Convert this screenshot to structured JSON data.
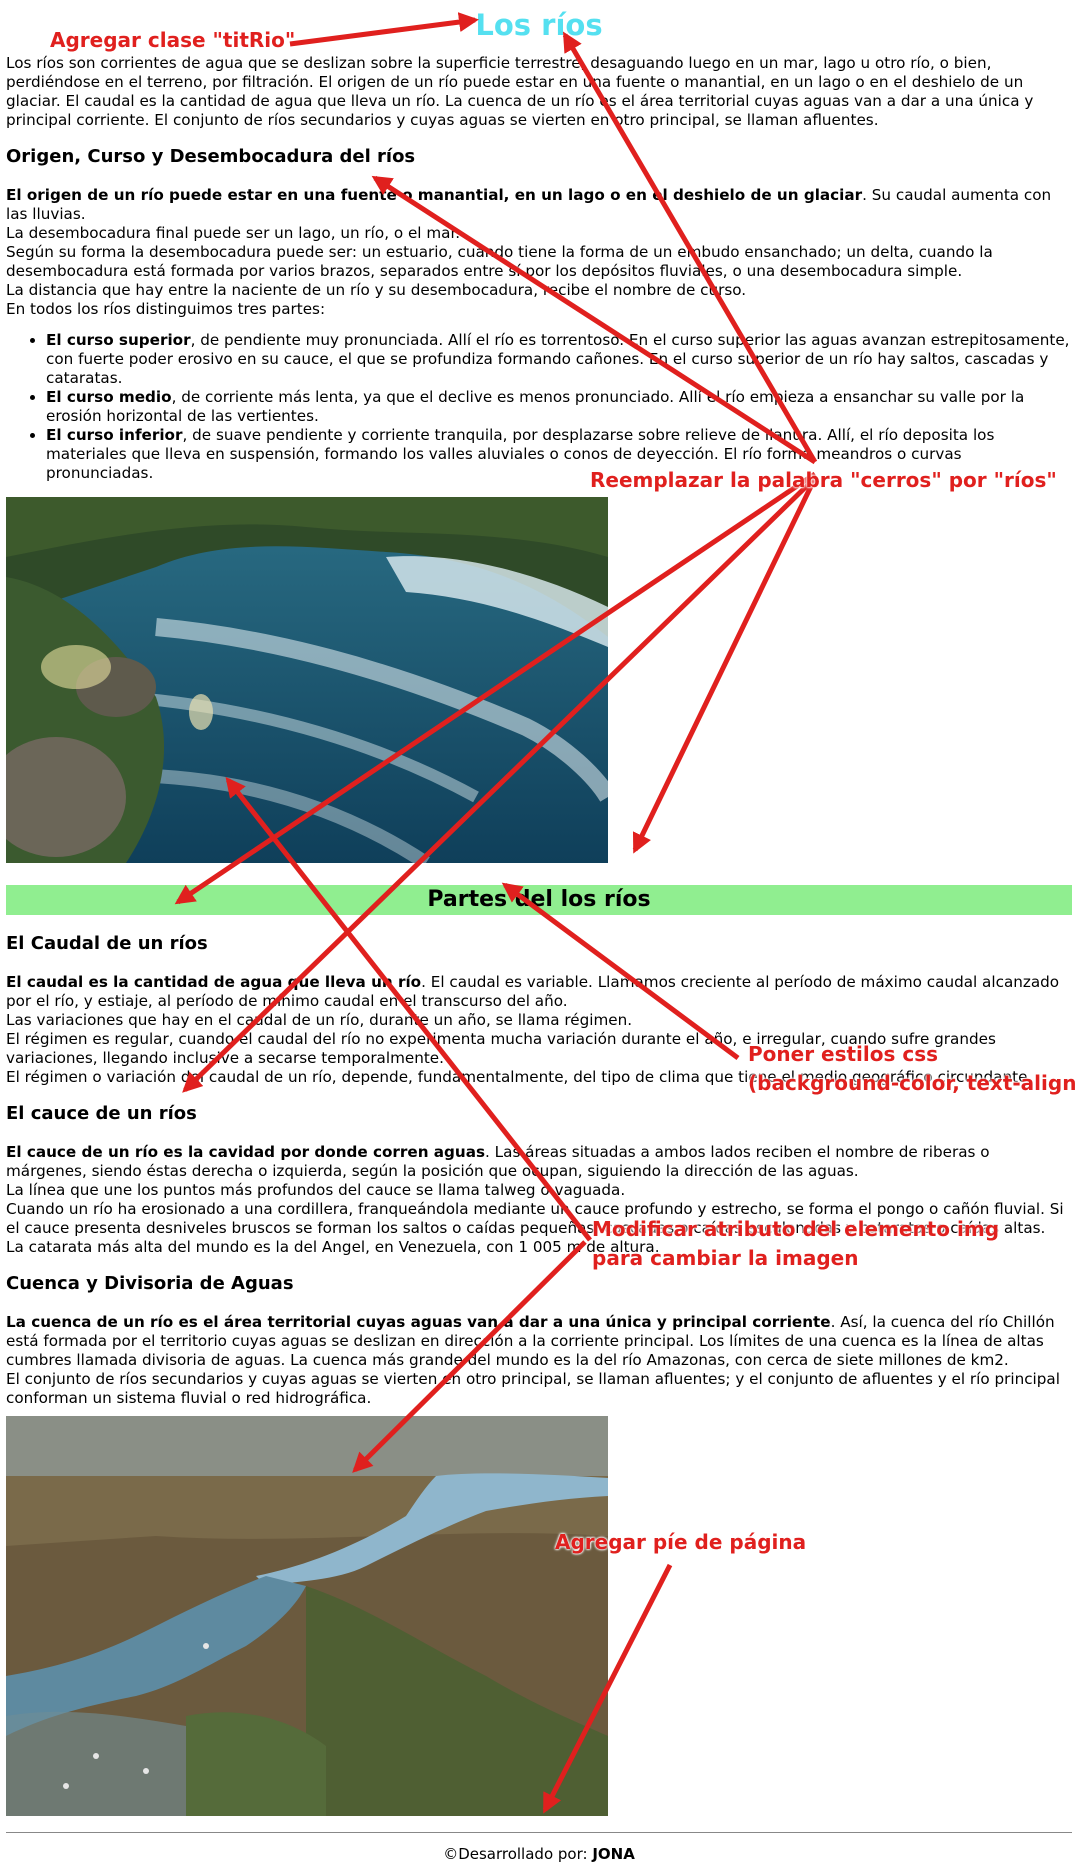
{
  "title": "Los ríos",
  "intro": "Los ríos son corrientes de agua que se deslizan sobre la superficie terrestre, desaguando luego en un mar, lago u otro río, o bien, perdiéndose en el terreno, por filtración. El origen de un río puede estar en una fuente o manantial, en un lago o en el deshielo de un glaciar. El caudal es la cantidad de agua que lleva un río. La cuenca de un río es el área territorial cuyas aguas van a dar a una única y principal corriente. El conjunto de ríos secundarios y cuyas aguas se vierten en otro principal, se llaman afluentes.",
  "s1": {
    "heading": "Origen, Curso y Desembocadura del ríos",
    "bold": "El origen de un río puede estar en una fuente o manantial, en un lago o en el deshielo de un glaciar",
    "rest": ". Su caudal aumenta con las lluvias.",
    "l2": "La desembocadura final puede ser un lago, un río, o el mar.",
    "l3": "Según su forma la desembocadura puede ser: un estuario, cuando tiene la forma de un embudo ensanchado; un delta, cuando la desembocadura está formada por varios brazos, separados entre sí por los depósitos fluviales, o una desembocadura simple.",
    "l4": "La distancia que hay entre la naciente de un río y su desembocadura, recibe el nombre de curso.",
    "l5": "En todos los ríos distinguimos tres partes:",
    "items": [
      {
        "b": "El curso superior",
        "t": ", de pendiente muy pronunciada. Allí el río es torrentoso. En el curso superior las aguas avanzan estrepitosamente, con fuerte poder erosivo en su cauce, el que se profundiza formando cañones. En el curso superior de un río hay saltos, cascadas y cataratas."
      },
      {
        "b": "El curso medio",
        "t": ", de corriente más lenta, ya que el declive es menos pronunciado. Allí el río empieza a ensanchar su valle por la erosión horizontal de las vertientes."
      },
      {
        "b": "El curso inferior",
        "t": ", de suave pendiente y corriente tranquila, por desplazarse sobre relieve de llanura. Allí, el río deposita los materiales que lleva en suspensión, formando los valles aluviales o conos de deyección. El río forma meandros o curvas pronunciadas."
      }
    ]
  },
  "parts_heading": "Partes del los ríos",
  "s2": {
    "heading": "El Caudal de un ríos",
    "bold": "El caudal es la cantidad de agua que lleva un río",
    "rest": ". El caudal es variable. Llamamos creciente al período de máximo caudal alcanzado por el río, y estiaje, al período de mínimo caudal en el transcurso del año.",
    "l2": "Las variaciones que hay en el caudal de un río, durante un año, se llama régimen.",
    "l3": "El régimen es regular, cuando el caudal del río no experimenta mucha variación durante el año, e irregular, cuando sufre grandes variaciones, llegando inclusive a secarse temporalmente.",
    "l4": "El régimen o variación del caudal de un río, depende, fundamentalmente, del tipo de clima que tiene el medio geográfico circundante."
  },
  "s3": {
    "heading": "El cauce de un ríos",
    "bold": "El cauce de un río es la cavidad por donde corren aguas",
    "rest": ". Las áreas situadas a ambos lados reciben el nombre de riberas o márgenes, siendo éstas derecha o izquierda, según la posición que ocupan, siguiendo la dirección de las aguas.",
    "l2": "La línea que une los puntos más profundos del cauce se llama talweg o vaguada.",
    "l3": "Cuando un río ha erosionado a una cordillera, franqueándola mediante un cauce profundo y estrecho, se forma el pongo o cañón fluvial. Si el cauce presenta desniveles bruscos se forman los saltos o caídas pequeñas; cascadas o caídas escalonadas y cataratas o caídas altas.",
    "l4": "La catarata más alta del mundo es la del Angel, en Venezuela, con 1 005 m de altura."
  },
  "s4": {
    "heading": "Cuenca y Divisoria de Aguas",
    "bold": "La cuenca de un río es el área territorial cuyas aguas van a dar a una única y principal corriente",
    "rest": ". Así, la cuenca del río Chillón está formada por el territorio cuyas aguas se deslizan en dirección a la corriente principal. Los límites de una cuenca es la línea de altas cumbres llamada divisoria de aguas. La cuenca más grande del mundo es la del río Amazonas, con cerca de siete millones de km2.",
    "l2": "El conjunto de ríos secundarios y cuyas aguas se vierten en otro principal, se llaman afluentes; y el conjunto de afluentes y el río principal conforman un sistema fluvial o red hidrográfica."
  },
  "footer": {
    "prefix": "©Desarrollado por: ",
    "author": "JONA"
  },
  "annotations": {
    "a1": "Agregar clase \"titRio\"",
    "a2": "Reemplazar la palabra \"cerros\" por \"ríos\"",
    "a3_1": "Poner estilos css",
    "a3_2": "(background-color, text-align)",
    "a4_1": "Modificar atributo del elemento img",
    "a4_2": "para cambiar la imagen",
    "a5": "Agregar píe de página"
  },
  "colors": {
    "title": "#55e0f0",
    "parts_bg": "#90ee90",
    "annotation": "#e0201e"
  }
}
